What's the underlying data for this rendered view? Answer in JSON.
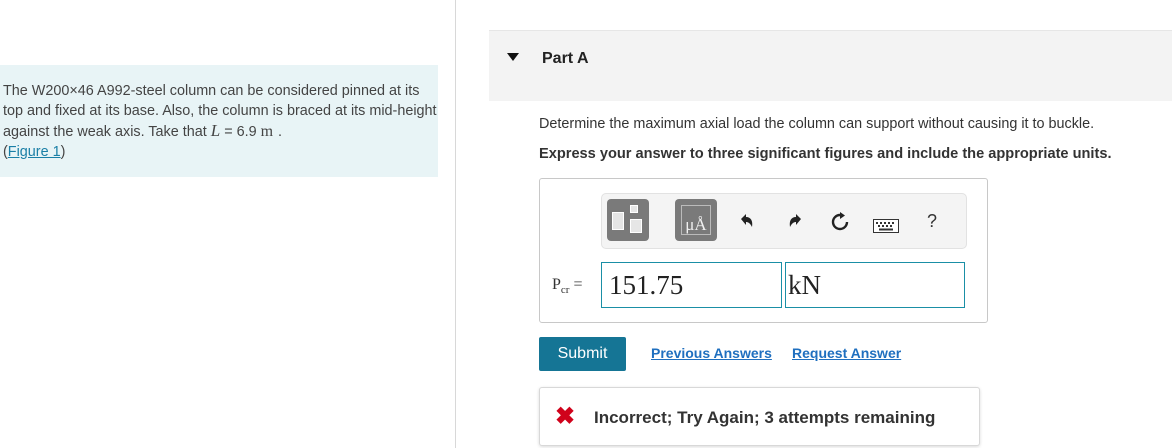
{
  "problem": {
    "text_before": "The W200×46 A992-steel column can be considered pinned at its top and fixed at its base. Also, the column is braced at its mid-height against the weak axis. Take that ",
    "variable": "L",
    "equals": " = 6.9 ",
    "unit": "m",
    "period": " .",
    "figure_link": "Figure 1",
    "figure_open": "(",
    "figure_close": ")"
  },
  "part": {
    "title": "Part A",
    "question": "Determine the maximum axial load the column can support without causing it to buckle.",
    "instruction": "Express your answer to three significant figures and include the appropriate units."
  },
  "toolbar": {
    "units_label": "μÅ",
    "undo_icon": "undo-arrow",
    "redo_icon": "redo-arrow",
    "reset_icon": "reset-circle-arrow",
    "keyboard_icon": "keyboard",
    "help_label": "?"
  },
  "answer": {
    "label_main": "P",
    "label_sub": "cr",
    "label_equals": " =",
    "value": "151.75",
    "unit": "kN"
  },
  "actions": {
    "submit_label": "Submit",
    "previous_answers": "Previous Answers",
    "request_answer": "Request Answer"
  },
  "feedback": {
    "icon": "✖",
    "text": "Incorrect; Try Again; 3 attempts remaining",
    "color": "#d0021b"
  }
}
